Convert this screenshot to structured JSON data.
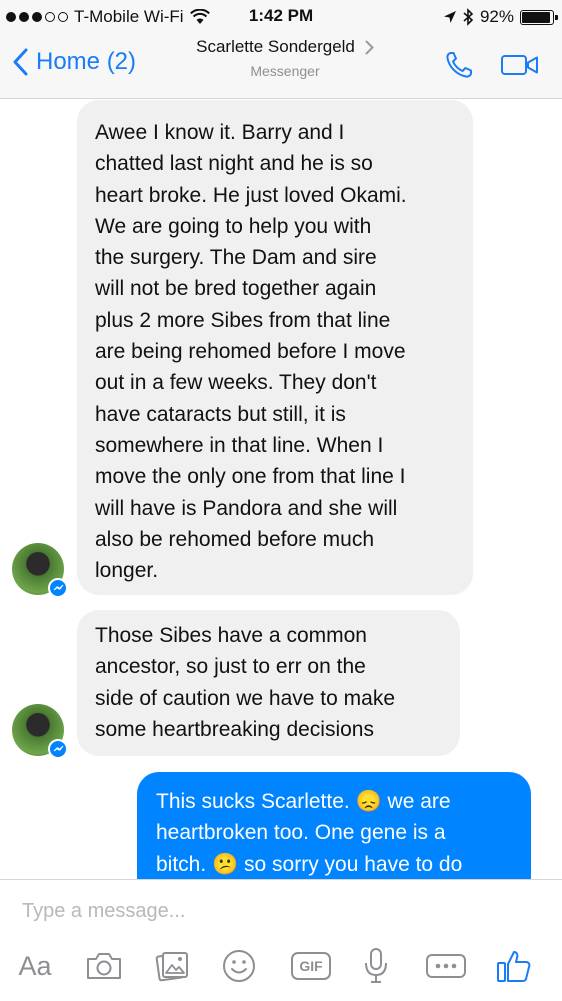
{
  "status_bar": {
    "carrier": "T-Mobile Wi-Fi",
    "time": "1:42 PM",
    "battery": "92%",
    "battery_level": 0.92
  },
  "header": {
    "back_label": "Home (2)",
    "contact_name": "Scarlette Sondergeld",
    "subtitle": "Messenger"
  },
  "messages": [
    {
      "direction": "incoming",
      "lines": [
        "Awee I know it. Barry and I",
        "chatted last night and he is so",
        "heart broke. He just loved Okami.",
        "We are going to help you with",
        "the surgery. The Dam and sire",
        "will not be bred together again",
        "plus 2 more Sibes from that line",
        "are being rehomed before I move",
        "out in a few weeks. They don't",
        "have cataracts but still, it is",
        "somewhere in that line. When I",
        "move the only one from that line I",
        "will have is Pandora and she will",
        "also be rehomed before much",
        "longer."
      ]
    },
    {
      "direction": "incoming",
      "lines": [
        "Those Sibes have a common",
        "ancestor, so just to err on the",
        "side of caution we have to make",
        "some heartbreaking decisions"
      ]
    },
    {
      "direction": "outgoing",
      "lines": [
        "This sucks Scarlette. 😞 we are",
        "heartbroken too. One gene is a",
        "bitch. 😕 so sorry you have to do"
      ]
    }
  ],
  "composer": {
    "placeholder": "Type a message...",
    "aa_label": "Aa",
    "gif_label": "GIF"
  },
  "colors": {
    "accent": "#1a7cf6",
    "outgoing_bubble": "#0084ff",
    "incoming_bubble": "#f1f0f0"
  },
  "icons": {
    "nav": [
      "chevron-left-icon",
      "chevron-right-icon",
      "phone-icon",
      "video-camera-icon"
    ],
    "status": [
      "wifi-icon",
      "location-arrow-icon",
      "bluetooth-icon",
      "battery-icon"
    ],
    "toolbar": [
      "camera-icon",
      "photo-gallery-icon",
      "emoji-icon",
      "gif-icon",
      "microphone-icon",
      "more-icon",
      "thumbs-up-icon"
    ]
  }
}
